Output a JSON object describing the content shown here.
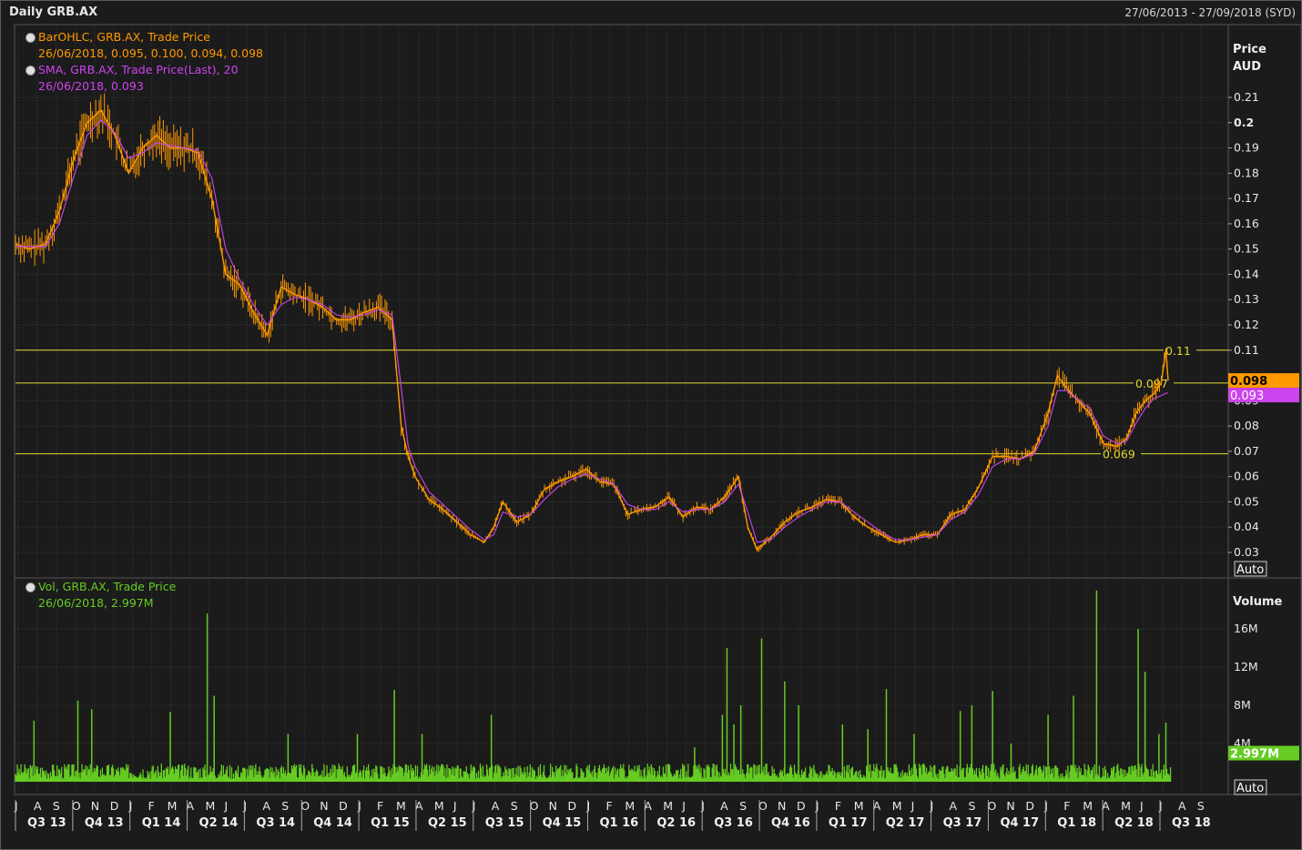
{
  "header": {
    "title": "Daily GRB.AX",
    "date_range": "27/06/2013 - 27/09/2018 (SYD)"
  },
  "legend": {
    "ohlc_line1": "BarOHLC, GRB.AX, Trade Price",
    "ohlc_line2": "26/06/2018, 0.095, 0.100, 0.094, 0.098",
    "sma_line1": "SMA, GRB.AX, Trade Price(Last),  20",
    "sma_line2": "26/06/2018, 0.093",
    "vol_line1": "Vol, GRB.AX, Trade Price",
    "vol_line2": "26/06/2018, 2.997M"
  },
  "colors": {
    "price": "#ff9900",
    "sma": "#cc44ee",
    "volume": "#66cc22",
    "hline": "#dddd33",
    "grid": "#3a3a3a",
    "background": "#1b1b1b"
  },
  "price_axis": {
    "title1": "Price",
    "title2": "AUD",
    "ticks": [
      "0.21",
      "0.2",
      "0.19",
      "0.18",
      "0.17",
      "0.16",
      "0.15",
      "0.14",
      "0.13",
      "0.12",
      "0.11",
      "0.09",
      "0.08",
      "0.07",
      "0.06",
      "0.05",
      "0.04",
      "0.03"
    ],
    "auto_label": "Auto",
    "last_price_tag": "0.098",
    "sma_tag": "0.093"
  },
  "volume_axis": {
    "title": "Volume",
    "ticks": [
      "16M",
      "12M",
      "8M",
      "4M"
    ],
    "auto_label": "Auto",
    "last_volume_tag": "2.997M"
  },
  "x_axis": {
    "months": [
      "J",
      "A",
      "S",
      "O",
      "N",
      "D",
      "J",
      "F",
      "M",
      "A",
      "M",
      "J",
      "J",
      "A",
      "S",
      "O",
      "N",
      "D",
      "J",
      "F",
      "M",
      "A",
      "M",
      "J",
      "J",
      "A",
      "S",
      "O",
      "N",
      "D",
      "J",
      "F",
      "M",
      "A",
      "M",
      "J",
      "J",
      "A",
      "S",
      "O",
      "N",
      "D",
      "J",
      "F",
      "M",
      "A",
      "M",
      "J",
      "J",
      "A",
      "S",
      "O",
      "N",
      "D",
      "J",
      "F",
      "M",
      "A",
      "M",
      "J",
      "J",
      "A",
      "S"
    ],
    "quarters": [
      "Q3 13",
      "Q4 13",
      "Q1 14",
      "Q2 14",
      "Q3 14",
      "Q4 14",
      "Q1 15",
      "Q2 15",
      "Q3 15",
      "Q4 15",
      "Q1 16",
      "Q2 16",
      "Q3 16",
      "Q4 16",
      "Q1 17",
      "Q2 17",
      "Q3 17",
      "Q4 17",
      "Q1 18",
      "Q2 18",
      "Q3 18"
    ]
  },
  "horizontal_lines": [
    {
      "value": 0.11,
      "label": "0.11"
    },
    {
      "value": 0.097,
      "label": "0.097"
    },
    {
      "value": 0.069,
      "label": "0.069"
    }
  ],
  "chart_data": {
    "type": "line",
    "title": "Daily GRB.AX",
    "x_range": [
      "27/06/2013",
      "27/09/2018"
    ],
    "ylabel": "Price AUD",
    "ylim": [
      0.025,
      0.215
    ],
    "grid": true,
    "series": [
      {
        "name": "BarOHLC, GRB.AX, Trade Price",
        "x": [
          2013.49,
          2013.55,
          2013.62,
          2013.68,
          2013.74,
          2013.8,
          2013.86,
          2013.92,
          2013.98,
          2014.04,
          2014.1,
          2014.16,
          2014.22,
          2014.28,
          2014.34,
          2014.4,
          2014.46,
          2014.52,
          2014.58,
          2014.64,
          2014.7,
          2014.76,
          2014.82,
          2014.88,
          2014.94,
          2015.0,
          2015.06,
          2015.12,
          2015.16,
          2015.19,
          2015.22,
          2015.28,
          2015.34,
          2015.4,
          2015.46,
          2015.52,
          2015.56,
          2015.6,
          2015.66,
          2015.72,
          2015.78,
          2015.84,
          2015.9,
          2015.96,
          2016.02,
          2016.08,
          2016.14,
          2016.2,
          2016.26,
          2016.32,
          2016.38,
          2016.44,
          2016.5,
          2016.56,
          2016.62,
          2016.66,
          2016.7,
          2016.76,
          2016.82,
          2016.88,
          2016.94,
          2017.0,
          2017.06,
          2017.12,
          2017.18,
          2017.24,
          2017.3,
          2017.36,
          2017.42,
          2017.48,
          2017.54,
          2017.6,
          2017.66,
          2017.72,
          2017.78,
          2017.84,
          2017.9,
          2017.96,
          2018.0,
          2018.04,
          2018.08,
          2018.14,
          2018.2,
          2018.26,
          2018.3,
          2018.34,
          2018.38,
          2018.42,
          2018.45,
          2018.47,
          2018.48
        ],
        "values": [
          0.152,
          0.15,
          0.152,
          0.165,
          0.185,
          0.2,
          0.205,
          0.195,
          0.18,
          0.19,
          0.195,
          0.19,
          0.19,
          0.188,
          0.17,
          0.14,
          0.136,
          0.125,
          0.116,
          0.135,
          0.132,
          0.13,
          0.127,
          0.122,
          0.122,
          0.125,
          0.127,
          0.122,
          0.08,
          0.068,
          0.06,
          0.051,
          0.047,
          0.042,
          0.037,
          0.034,
          0.04,
          0.05,
          0.042,
          0.045,
          0.055,
          0.058,
          0.06,
          0.063,
          0.058,
          0.057,
          0.045,
          0.047,
          0.048,
          0.052,
          0.044,
          0.048,
          0.047,
          0.052,
          0.06,
          0.04,
          0.031,
          0.036,
          0.042,
          0.046,
          0.048,
          0.051,
          0.05,
          0.044,
          0.04,
          0.037,
          0.034,
          0.035,
          0.037,
          0.037,
          0.045,
          0.047,
          0.056,
          0.068,
          0.068,
          0.067,
          0.07,
          0.085,
          0.1,
          0.095,
          0.091,
          0.085,
          0.073,
          0.072,
          0.075,
          0.085,
          0.09,
          0.093,
          0.097,
          0.11,
          0.098
        ]
      },
      {
        "name": "SMA, GRB.AX, Trade Price(Last),  20",
        "x": [
          2013.49,
          2013.55,
          2013.62,
          2013.68,
          2013.74,
          2013.8,
          2013.86,
          2013.92,
          2013.98,
          2014.04,
          2014.1,
          2014.16,
          2014.22,
          2014.28,
          2014.34,
          2014.4,
          2014.46,
          2014.52,
          2014.58,
          2014.64,
          2014.7,
          2014.76,
          2014.82,
          2014.88,
          2014.94,
          2015.0,
          2015.06,
          2015.12,
          2015.16,
          2015.19,
          2015.22,
          2015.28,
          2015.34,
          2015.4,
          2015.46,
          2015.52,
          2015.56,
          2015.6,
          2015.66,
          2015.72,
          2015.78,
          2015.84,
          2015.9,
          2015.96,
          2016.02,
          2016.08,
          2016.14,
          2016.2,
          2016.26,
          2016.32,
          2016.38,
          2016.44,
          2016.5,
          2016.56,
          2016.62,
          2016.66,
          2016.7,
          2016.76,
          2016.82,
          2016.88,
          2016.94,
          2017.0,
          2017.06,
          2017.12,
          2017.18,
          2017.24,
          2017.3,
          2017.36,
          2017.42,
          2017.48,
          2017.54,
          2017.6,
          2017.66,
          2017.72,
          2017.78,
          2017.84,
          2017.9,
          2017.96,
          2018.0,
          2018.04,
          2018.08,
          2018.14,
          2018.2,
          2018.26,
          2018.3,
          2018.34,
          2018.38,
          2018.42,
          2018.45,
          2018.47,
          2018.48
        ],
        "values": [
          0.151,
          0.151,
          0.151,
          0.16,
          0.178,
          0.195,
          0.201,
          0.196,
          0.186,
          0.188,
          0.192,
          0.191,
          0.19,
          0.189,
          0.178,
          0.15,
          0.138,
          0.128,
          0.12,
          0.128,
          0.131,
          0.13,
          0.128,
          0.124,
          0.123,
          0.124,
          0.126,
          0.124,
          0.095,
          0.072,
          0.064,
          0.054,
          0.049,
          0.044,
          0.039,
          0.035,
          0.037,
          0.046,
          0.044,
          0.045,
          0.051,
          0.056,
          0.059,
          0.061,
          0.059,
          0.057,
          0.049,
          0.047,
          0.047,
          0.05,
          0.046,
          0.047,
          0.047,
          0.05,
          0.057,
          0.046,
          0.034,
          0.035,
          0.04,
          0.044,
          0.047,
          0.05,
          0.05,
          0.046,
          0.042,
          0.038,
          0.035,
          0.035,
          0.036,
          0.037,
          0.043,
          0.046,
          0.053,
          0.064,
          0.067,
          0.067,
          0.069,
          0.08,
          0.094,
          0.094,
          0.091,
          0.087,
          0.076,
          0.073,
          0.074,
          0.081,
          0.087,
          0.091,
          0.092,
          0.093,
          0.093
        ]
      }
    ],
    "volume": {
      "name": "Vol, GRB.AX, Trade Price",
      "ylabel": "Volume",
      "ylim": [
        0,
        20000000
      ],
      "spikes_x": [
        2013.57,
        2013.76,
        2013.82,
        2014.16,
        2014.32,
        2014.35,
        2014.67,
        2014.97,
        2015.13,
        2015.25,
        2015.55,
        2016.43,
        2016.55,
        2016.57,
        2016.6,
        2016.63,
        2016.72,
        2016.82,
        2016.88,
        2017.07,
        2017.18,
        2017.26,
        2017.38,
        2017.58,
        2017.63,
        2017.72,
        2017.8,
        2017.96,
        2018.07,
        2018.17,
        2018.35,
        2018.38,
        2018.44,
        2018.47
      ],
      "spikes_values": [
        6400000,
        8500000,
        7600000,
        7300000,
        17600000,
        9000000,
        5000000,
        5000000,
        9600000,
        5000000,
        7000000,
        3600000,
        7000000,
        14000000,
        6000000,
        8000000,
        15000000,
        10500000,
        8000000,
        6000000,
        5500000,
        9700000,
        5000000,
        7400000,
        8000000,
        9500000,
        4000000,
        7000000,
        9000000,
        20000000,
        16000000,
        11500000,
        5000000,
        6200000
      ],
      "baseline_value": 1000000,
      "last_value": 2997000
    }
  }
}
